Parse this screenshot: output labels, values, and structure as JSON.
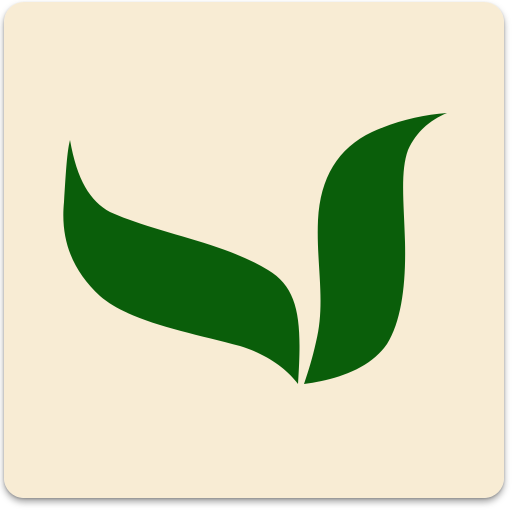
{
  "icon": {
    "name": "sprout-leaves-icon",
    "colors": {
      "background": "#F8ECD4",
      "leaf": "#0A5E0A"
    }
  }
}
